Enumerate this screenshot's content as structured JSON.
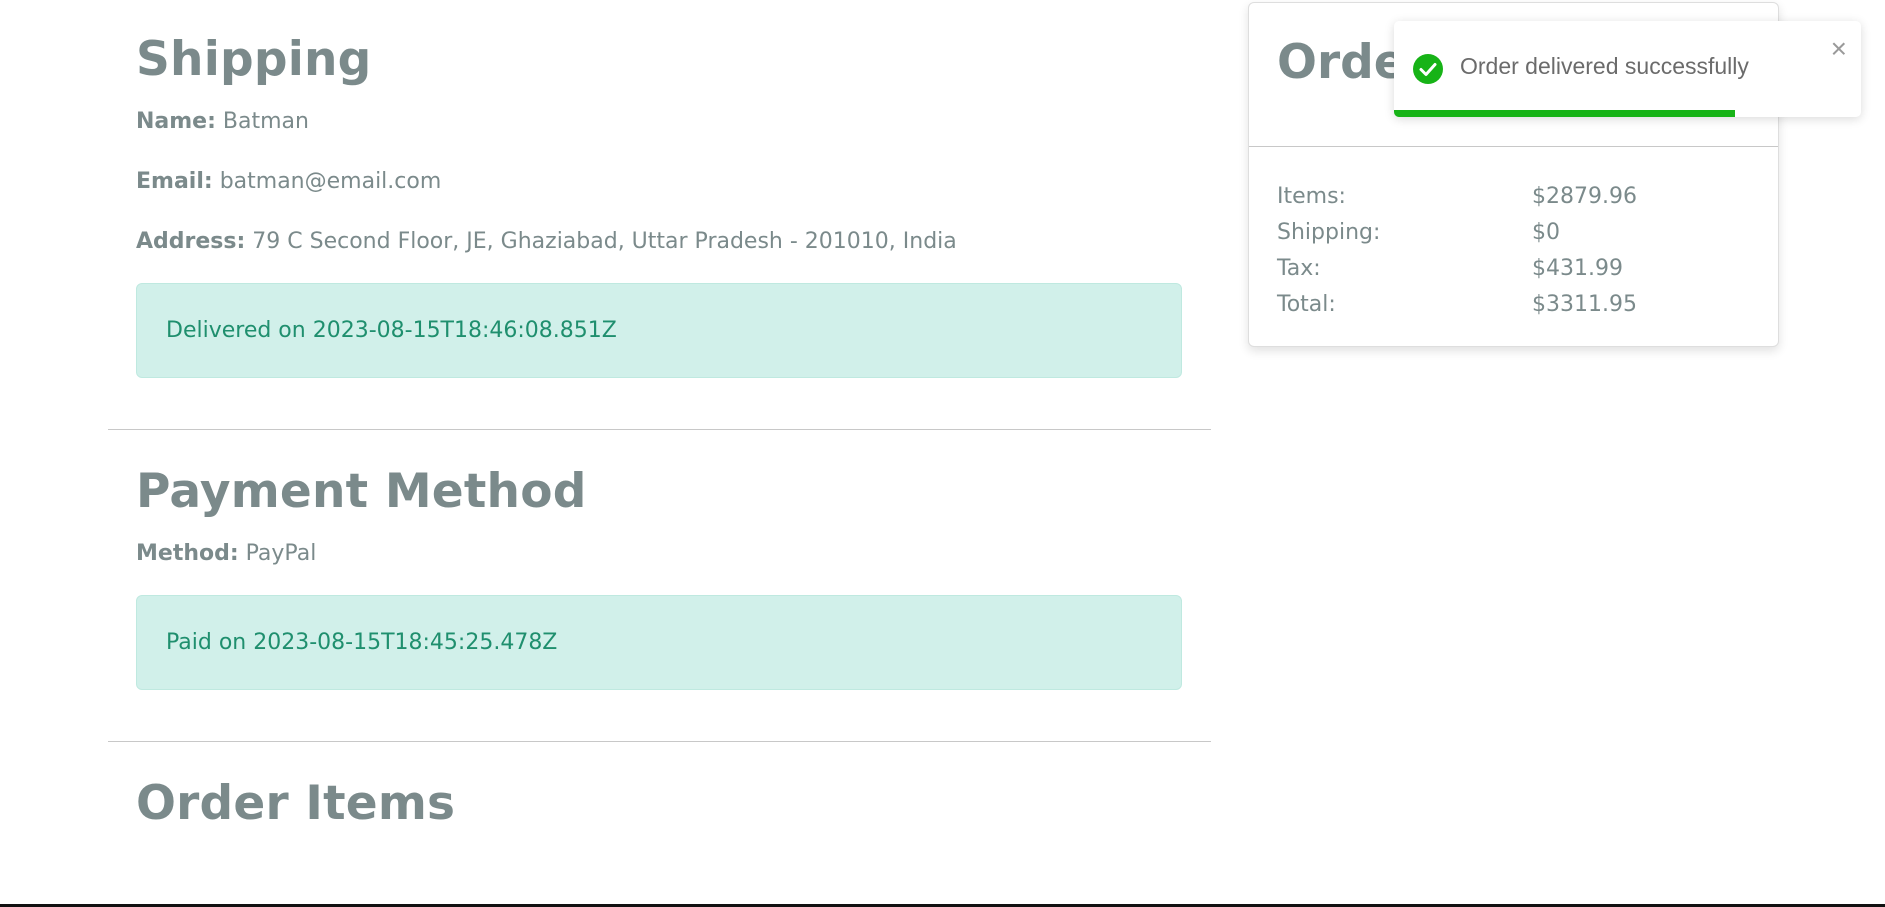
{
  "shipping": {
    "title": "Shipping",
    "name_label": "Name:",
    "name_value": "Batman",
    "email_label": "Email:",
    "email_value": "batman@email.com",
    "address_label": "Address:",
    "address_value": "79 C Second Floor, JE, Ghaziabad, Uttar Pradesh - 201010, India",
    "delivered_alert": "Delivered on 2023-08-15T18:46:08.851Z"
  },
  "payment": {
    "title": "Payment Method",
    "method_label": "Method:",
    "method_value": "PayPal",
    "paid_alert": "Paid on 2023-08-15T18:45:25.478Z"
  },
  "order_items": {
    "title": "Order Items"
  },
  "summary": {
    "title": "Order Summary",
    "rows": [
      {
        "label": "Items:",
        "value": "$2879.96"
      },
      {
        "label": "Shipping:",
        "value": "$0"
      },
      {
        "label": "Tax:",
        "value": "$431.99"
      },
      {
        "label": "Total:",
        "value": "$3311.95"
      }
    ]
  },
  "toast": {
    "message": "Order delivered successfully",
    "close_symbol": "×",
    "progress_fraction": 0.73,
    "icon": "check-circle-icon",
    "color": "#17b317"
  },
  "colors": {
    "alert_bg": "#d1f0ea",
    "alert_text": "#1f8f6e",
    "heading": "#7b8a8b"
  }
}
